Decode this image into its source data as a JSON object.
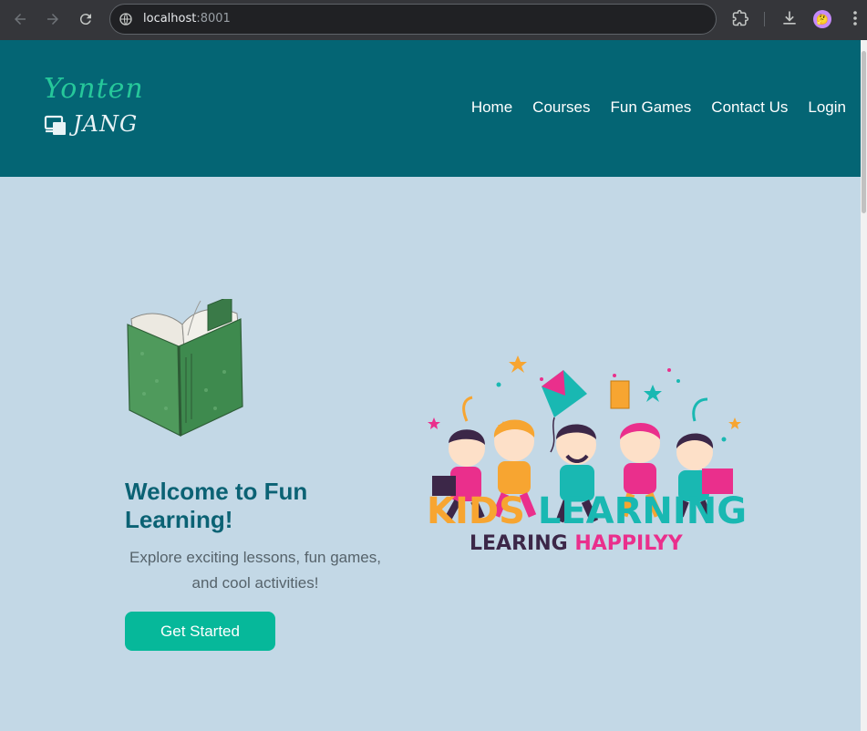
{
  "browser": {
    "url_host": "localhost",
    "url_port": ":8001"
  },
  "site": {
    "logo_top": "Yonten",
    "logo_bottom": "JANG",
    "nav": [
      "Home",
      "Courses",
      "Fun Games",
      "Contact Us",
      "Login"
    ]
  },
  "hero": {
    "title": "Welcome to Fun Learning!",
    "subtitle": "Explore exciting lessons, fun games, and cool activities!",
    "cta_label": "Get Started"
  },
  "banner": {
    "title_part1": "KIDS ",
    "title_part2": "LEARNING",
    "sub_part1": "LEARING ",
    "sub_part2": "HAPPILYY"
  },
  "colors": {
    "header_bg": "#046574",
    "page_bg": "#c3d8e6",
    "accent": "#06b89a",
    "title": "#0b6274"
  }
}
